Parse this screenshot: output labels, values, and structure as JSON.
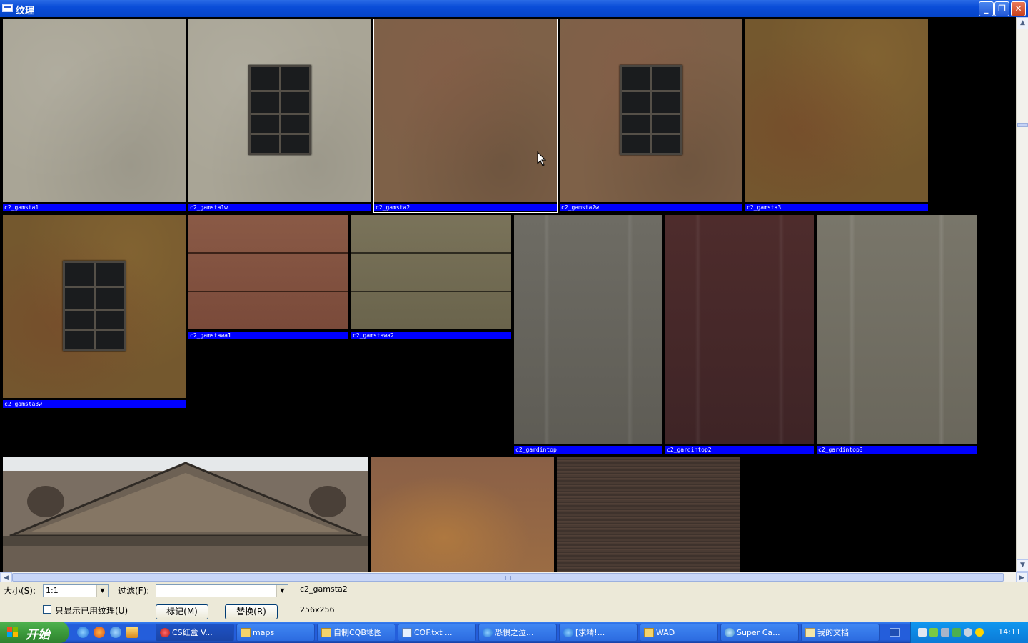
{
  "window": {
    "title": "纹理",
    "controls": {
      "minimize": "_",
      "maximize": "❐",
      "close": "✕"
    }
  },
  "textures": [
    {
      "name": "c2_gamsta1"
    },
    {
      "name": "c2_gamsta1w"
    },
    {
      "name": "c2_gamsta2",
      "selected": true
    },
    {
      "name": "c2_gamsta2w"
    },
    {
      "name": "c2_gamsta3"
    },
    {
      "name": "c2_gamsta3w"
    },
    {
      "name": "c2_gamstawa1"
    },
    {
      "name": "c2_gamstawa2"
    },
    {
      "name": "c2_gardintop"
    },
    {
      "name": "c2_gardintop2"
    },
    {
      "name": "c2_gardintop3"
    }
  ],
  "panel": {
    "size_label": "大小(S):",
    "size_value": "1:1",
    "filter_label": "过滤(F):",
    "filter_value": "",
    "selected_texture": "c2_gamsta2",
    "texture_dimensions": "256x256",
    "only_used_label": "只显示已用纹理(U)",
    "mark_button": "标记(M)",
    "replace_button": "替换(R)"
  },
  "taskbar": {
    "start_label": "开始",
    "tasks": [
      {
        "label": "CS红盒 V..."
      },
      {
        "label": "maps"
      },
      {
        "label": "自制CQB地图"
      },
      {
        "label": "COF.txt ..."
      },
      {
        "label": "恐惧之泣..."
      },
      {
        "label": "[求精!..."
      },
      {
        "label": "WAD"
      },
      {
        "label": "Super Ca..."
      },
      {
        "label": "我的文档"
      }
    ],
    "clock": "14:11"
  },
  "colors": {
    "label_bg": "#0000ff",
    "titlebar": "#0a4dd8",
    "panel_bg": "#ece9d8",
    "taskbar": "#245edb",
    "start": "#3c9a3c",
    "tray": "#0c7ad6"
  }
}
